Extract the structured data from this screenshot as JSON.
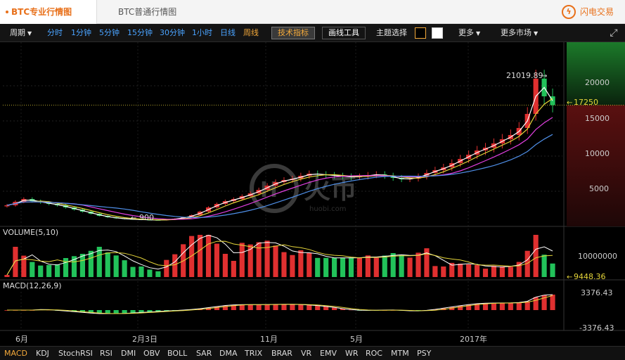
{
  "tabs": {
    "active": "BTC专业行情图",
    "inactive": "BTC普通行情图"
  },
  "brand": {
    "name": "闪电交易",
    "icon": "lightning-icon"
  },
  "toolbar": {
    "period_label": "周期",
    "intervals": [
      "分时",
      "1分钟",
      "5分钟",
      "15分钟",
      "30分钟",
      "1小时",
      "日线"
    ],
    "active_interval": "周线",
    "tech_indicator_label": "技术指标",
    "drawing_tools_label": "画线工具",
    "theme_label": "主题选择",
    "more_label": "更多",
    "more_markets_label": "更多市场"
  },
  "colors": {
    "up": "#e03030",
    "down": "#22c25a",
    "ma1": "#ffffff",
    "ma2": "#e6d63a",
    "ma3": "#e13fe0",
    "ma4": "#4f8fe8",
    "accent": "#e8701a",
    "price_tag": "#e6d63a"
  },
  "chart_data": [
    {
      "type": "candlestick",
      "title": "",
      "x_ticks": [
        "6月",
        "2月3日",
        "11月",
        "5月",
        "2017年"
      ],
      "y_ticks": [
        5000,
        10000,
        15000,
        20000
      ],
      "ylim": [
        0,
        22000
      ],
      "annotations": {
        "high_label": "21019.89",
        "low_label": "900",
        "last_price": "17250"
      },
      "series": {
        "close": [
          3000,
          3500,
          3900,
          3600,
          3400,
          3200,
          3000,
          2700,
          2400,
          2100,
          1800,
          1500,
          1300,
          1150,
          1050,
          1000,
          950,
          920,
          900,
          980,
          1100,
          1300,
          1600,
          2100,
          2700,
          3200,
          3600,
          3900,
          4300,
          4700,
          5200,
          5800,
          6300,
          6600,
          6800,
          7200,
          7500,
          7400,
          7300,
          7200,
          7100,
          7000,
          7100,
          7300,
          7400,
          7200,
          6900,
          6700,
          6800,
          7100,
          7600,
          8000,
          8400,
          9000,
          9600,
          10200,
          10800,
          11200,
          11800,
          12400,
          13000,
          14000,
          16000,
          21019,
          18500,
          17250
        ]
      }
    },
    {
      "type": "bar",
      "title": "VOLUME(5,10)",
      "y_ticks": [
        10000000
      ],
      "annotations": {
        "last_label": "9448.36"
      }
    },
    {
      "type": "bar",
      "title": "MACD(12,26,9)",
      "y_ticks": [
        3376.43,
        -3376.43
      ]
    }
  ],
  "indicators": [
    "KDJ",
    "StochRSI",
    "RSI",
    "DMI",
    "OBV",
    "BOLL",
    "SAR",
    "DMA",
    "TRIX",
    "BRAR",
    "VR",
    "EMV",
    "WR",
    "ROC",
    "MTM",
    "PSY"
  ],
  "active_indicator": "MACD",
  "watermark": {
    "text": "火币",
    "sub": "huobi.com"
  }
}
